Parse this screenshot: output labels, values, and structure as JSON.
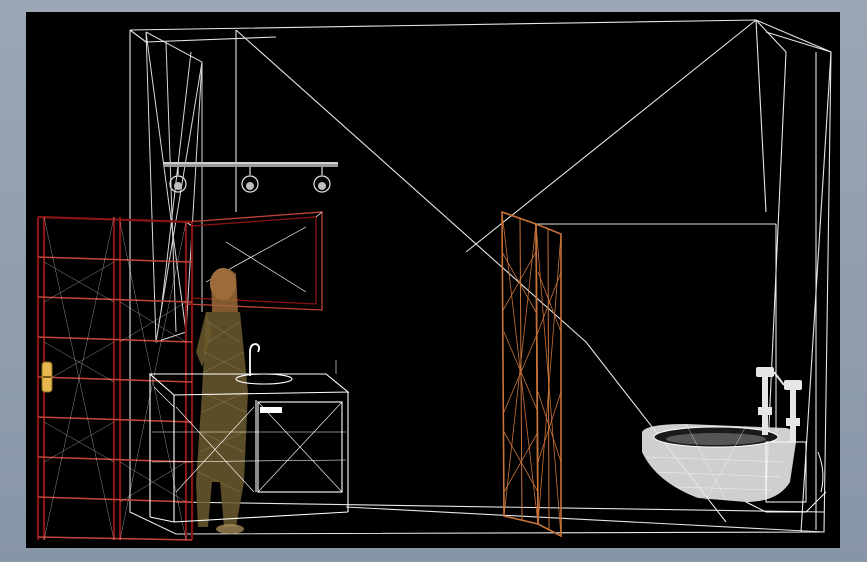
{
  "viewport": {
    "label": "",
    "background": "#000000"
  },
  "colors": {
    "wire_white": "#ffffff",
    "wire_gray": "#cfcfcf",
    "shelf_red": "#8a1414",
    "shelf_red_light": "#c0443a",
    "partition_orange": "#c8733a",
    "figure_brown": "#6b5a2e",
    "figure_hair": "#b7834a",
    "fixture_white": "#e6e6e6",
    "tag_yellow": "#e8b850"
  },
  "scene": {
    "objects": [
      "room-wireframe-icon",
      "shelving-unit-icon",
      "track-light-icon",
      "mirror-icon",
      "vanity-sink-icon",
      "human-figure-icon",
      "partition-screen-icon",
      "wall-toilet-icon",
      "flush-valve-icon"
    ]
  }
}
